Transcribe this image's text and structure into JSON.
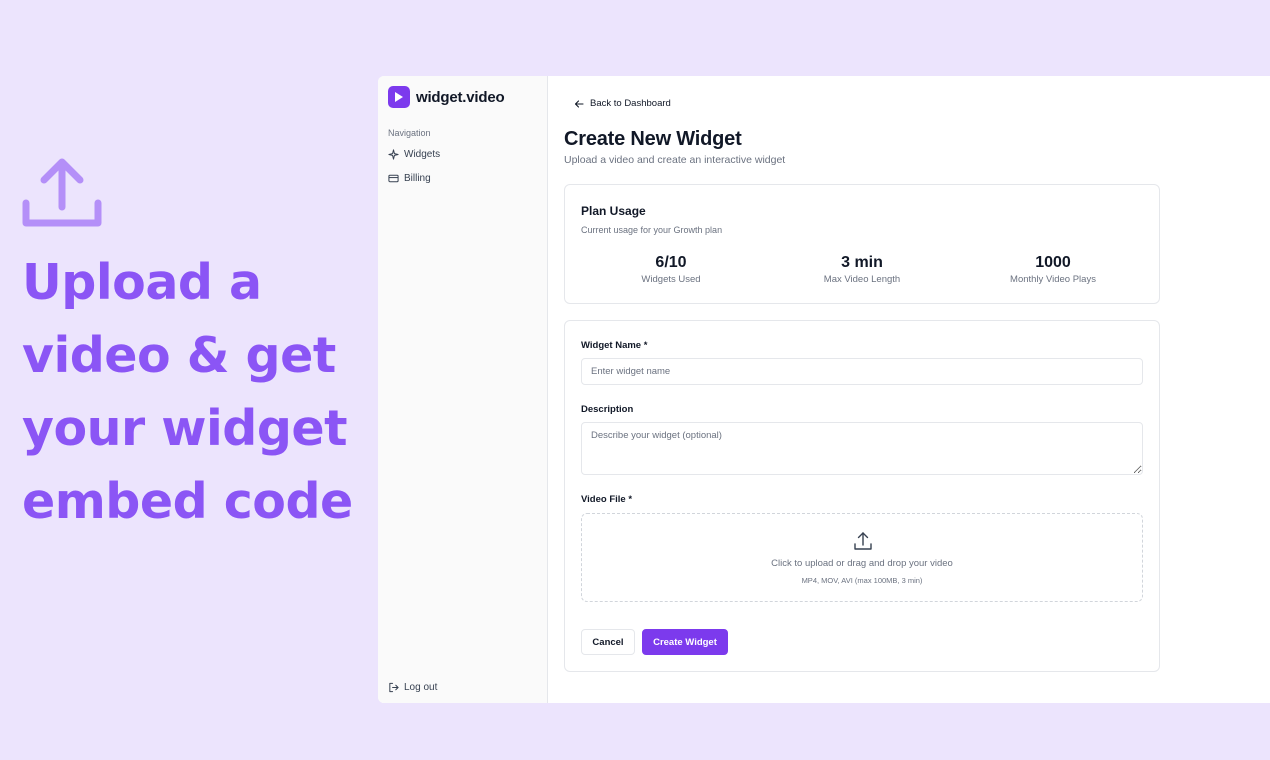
{
  "hero": {
    "lines": [
      "Upload a",
      "video & get",
      "your widget",
      "embed code"
    ]
  },
  "app": {
    "brand": "widget.video",
    "nav_caption": "Navigation",
    "nav_items": [
      {
        "label": "Widgets",
        "icon": "sparkle-icon"
      },
      {
        "label": "Billing",
        "icon": "credit-card-icon"
      }
    ],
    "logout_label": "Log out"
  },
  "main": {
    "back_label": "Back to Dashboard",
    "title": "Create New Widget",
    "subtitle": "Upload a video and create an interactive widget"
  },
  "usage": {
    "title": "Plan Usage",
    "subtitle": "Current usage for your Growth plan",
    "stats": [
      {
        "value": "6/10",
        "label": "Widgets Used"
      },
      {
        "value": "3 min",
        "label": "Max Video Length"
      },
      {
        "value": "1000",
        "label": "Monthly Video Plays"
      }
    ]
  },
  "form": {
    "name_label": "Widget Name *",
    "name_placeholder": "Enter widget name",
    "desc_label": "Description",
    "desc_placeholder": "Describe your widget (optional)",
    "file_label": "Video File *",
    "dropzone_text": "Click to upload or drag and drop your video",
    "dropzone_hint": "MP4, MOV, AVI (max 100MB, 3 min)",
    "cancel_label": "Cancel",
    "create_label": "Create Widget"
  },
  "colors": {
    "background": "#ece4fd",
    "hero_text": "#8b55f5",
    "accent": "#7c3aed"
  }
}
